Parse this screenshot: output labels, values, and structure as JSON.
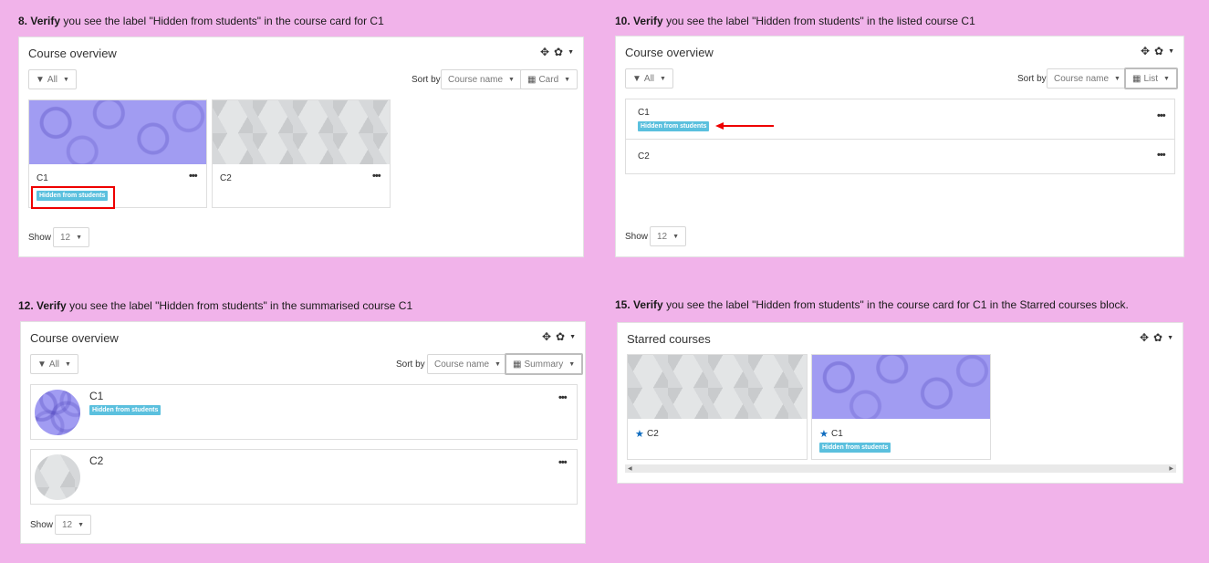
{
  "captions": {
    "c8": {
      "num": "8.",
      "verify": "Verify",
      "rest": " you see the label \"Hidden from students\" in the course card for C1"
    },
    "c10": {
      "num": "10.",
      "verify": "Verify",
      "rest": " you see the label \"Hidden from students\" in the listed course C1"
    },
    "c12": {
      "num": "12.",
      "verify": "Verify",
      "rest": " you see the label \"Hidden from students\" in the summarised course C1"
    },
    "c15": {
      "num": "15.",
      "verify": "Verify",
      "rest": " you see the label \"Hidden from students\" in the course card for C1 in the Starred courses block."
    }
  },
  "common": {
    "overview_title": "Course overview",
    "starred_title": "Starred courses",
    "filter_all": "All",
    "sort_by": "Sort by",
    "sort_value": "Course name",
    "show_label": "Show",
    "show_value": "12",
    "hidden_badge": "Hidden from students",
    "dots": "•••",
    "move_icon": "✥",
    "gear_icon": "✿",
    "caret": "▼"
  },
  "views": {
    "card": "Card",
    "list": "List",
    "summary": "Summary"
  },
  "courses": {
    "c1": "C1",
    "c2": "C2"
  },
  "colors": {
    "badge": "#5bc0de",
    "highlight": "#ee0000",
    "star": "#0f6cbf",
    "background": "#f1b3ea"
  }
}
